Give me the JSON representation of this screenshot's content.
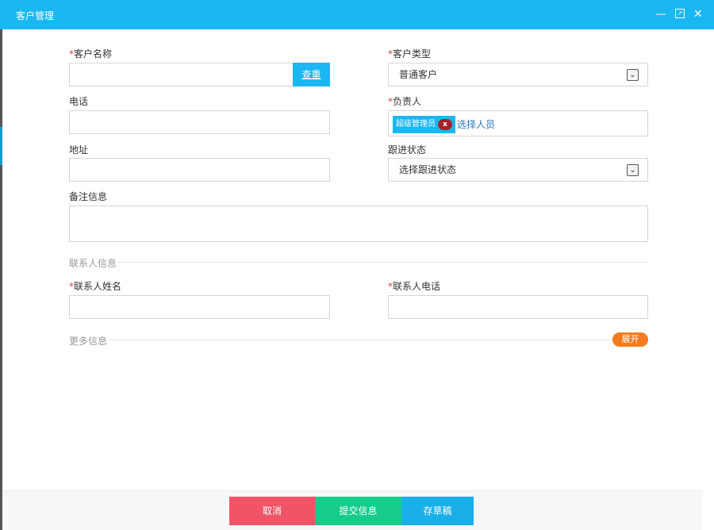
{
  "window": {
    "title": "客户管理",
    "minimize_icon": "minimize-icon",
    "maximize_icon": "maximize-icon",
    "close_icon": "close-icon"
  },
  "form": {
    "required_mark": "*",
    "customer_name": {
      "label": "客户名称",
      "value": "",
      "check_button": "查重"
    },
    "customer_type": {
      "label": "客户类型",
      "selected": "普通客户"
    },
    "phone": {
      "label": "电话",
      "value": ""
    },
    "owner": {
      "label": "负责人",
      "tag": "超级管理员",
      "tag_remove": "x",
      "pick_link": "选择人员"
    },
    "address": {
      "label": "地址",
      "value": ""
    },
    "follow_status": {
      "label": "跟进状态",
      "selected": "选择跟进状态"
    },
    "remarks": {
      "label": "备注信息",
      "value": ""
    },
    "contact_section": "联系人信息",
    "contact_name": {
      "label": "联系人姓名",
      "value": ""
    },
    "contact_phone": {
      "label": "联系人电话",
      "value": ""
    },
    "more_section": "更多信息",
    "expand_button": "展开"
  },
  "footer": {
    "cancel": "取消",
    "submit": "提交信息",
    "draft": "存草稿"
  },
  "colors": {
    "titlebar": "#1bb7f2",
    "cancel": "#ef5467",
    "submit": "#17cc8a",
    "draft": "#1aafe9",
    "expand": "#f47c20"
  }
}
